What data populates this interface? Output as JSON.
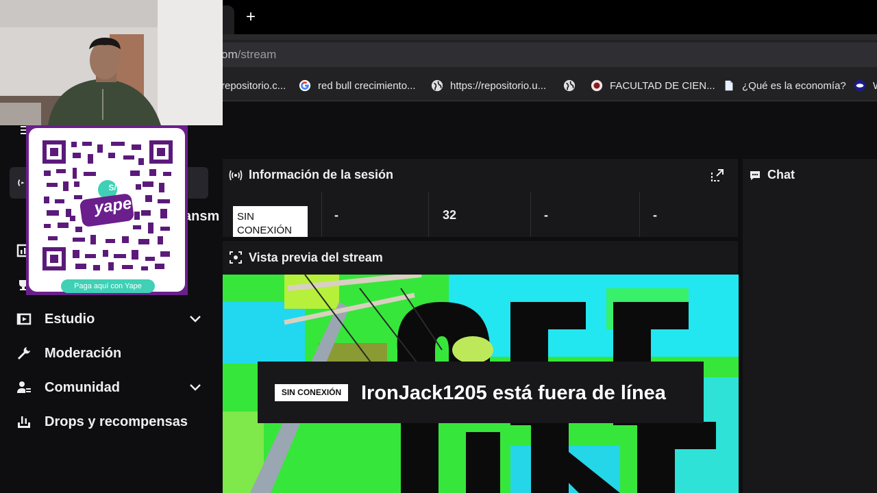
{
  "browser": {
    "new_tab_label": "+",
    "url_host": "om",
    "url_path": "/stream",
    "bookmarks": [
      {
        "label": "repositorio.c...",
        "icon": "none"
      },
      {
        "label": "red bull crecimiento...",
        "icon": "google-icon"
      },
      {
        "label": "https://repositorio.u...",
        "icon": "globe-icon"
      },
      {
        "label": "",
        "icon": "globe-icon"
      },
      {
        "label": "FACULTAD DE CIEN...",
        "icon": "university-icon"
      },
      {
        "label": "¿Qué es la economía?",
        "icon": "document-icon"
      },
      {
        "label": "W",
        "icon": "site-icon"
      }
    ]
  },
  "sidebar": {
    "partial_text": "ansm",
    "items": [
      {
        "label": "Estudio",
        "icon": "studio-icon",
        "expandable": true
      },
      {
        "label": "Moderación",
        "icon": "wrench-icon",
        "expandable": false
      },
      {
        "label": "Comunidad",
        "icon": "community-icon",
        "expandable": true
      },
      {
        "label": "Drops y recompensas",
        "icon": "drops-icon",
        "expandable": false
      }
    ]
  },
  "session": {
    "title": "Información de la sesión",
    "status": "SIN CONEXIÓN",
    "stats": [
      "-",
      "32",
      "-",
      "-"
    ]
  },
  "preview": {
    "title": "Vista previa del stream",
    "badge": "SIN CONEXIÓN",
    "message": "IronJack1205 está fuera de línea"
  },
  "chat": {
    "title": "Chat"
  },
  "overlay": {
    "qr_pill": "Paga aquí con Yape",
    "qr_logo_text": "yape",
    "qr_currency": "S/"
  },
  "colors": {
    "accent_purple": "#6a1f8c",
    "yape_teal": "#3fd0b5",
    "panel_bg": "#18181b",
    "app_bg": "#0e0e10"
  }
}
